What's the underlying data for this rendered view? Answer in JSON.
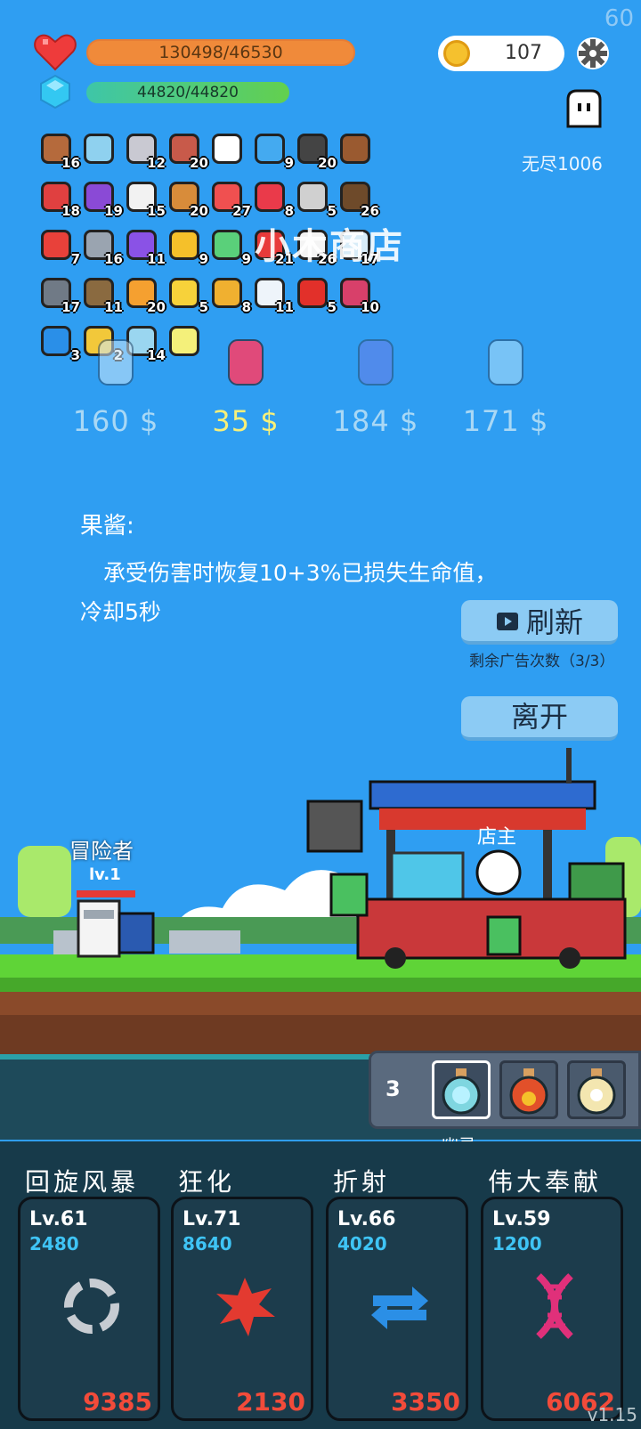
{
  "fps": "60",
  "status": {
    "hp_text": "130498/46530",
    "mp_text": "44820/44820",
    "coins": "107",
    "mode_label": "无尽1006"
  },
  "inventory": [
    {
      "name": "ring-icon",
      "count": "16",
      "color": "#b56a3c"
    },
    {
      "name": "magnifier-icon",
      "count": "",
      "color": "#8fd1ef"
    },
    {
      "name": "sword-icon",
      "count": "12",
      "color": "#c9c9d2"
    },
    {
      "name": "tombstone-icon",
      "count": "20",
      "color": "#c85a4a"
    },
    {
      "name": "target-icon",
      "count": "",
      "color": "#ffffff"
    },
    {
      "name": "speech-bubble-icon",
      "count": "9",
      "color": "#44aaf0"
    },
    {
      "name": "bomb-icon",
      "count": "20",
      "color": "#444444"
    },
    {
      "name": "treasure-chest-icon",
      "count": "",
      "color": "#9a5a30"
    },
    {
      "name": "shield-icon",
      "count": "18",
      "color": "#e04040"
    },
    {
      "name": "gift-box-icon",
      "count": "19",
      "color": "#8a4ad6"
    },
    {
      "name": "dice-icon",
      "count": "15",
      "color": "#f2f2f2"
    },
    {
      "name": "bow-icon",
      "count": "20",
      "color": "#d88c3a"
    },
    {
      "name": "pill-icon",
      "count": "27",
      "color": "#f05050"
    },
    {
      "name": "hearts-icon",
      "count": "8",
      "color": "#ea3a4a"
    },
    {
      "name": "hook-icon",
      "count": "5",
      "color": "#d0d0d0"
    },
    {
      "name": "coconut-icon",
      "count": "26",
      "color": "#6e4a2a"
    },
    {
      "name": "watermelon-icon",
      "count": "7",
      "color": "#e8413a"
    },
    {
      "name": "elephant-icon",
      "count": "16",
      "color": "#9aa4b0"
    },
    {
      "name": "crystal-ball-icon",
      "count": "11",
      "color": "#8a52e6"
    },
    {
      "name": "sunflower-icon",
      "count": "9",
      "color": "#f5c02a"
    },
    {
      "name": "green-ghost-icon",
      "count": "9",
      "color": "#5ad07a"
    },
    {
      "name": "strawberry-icon",
      "count": "21",
      "color": "#e83a3a"
    },
    {
      "name": "white-ghost-icon",
      "count": "26",
      "color": "#f4f4f4"
    },
    {
      "name": "bubble-icon",
      "count": "17",
      "color": "#d8ecf8"
    },
    {
      "name": "spiked-mace-icon",
      "count": "17",
      "color": "#707a86"
    },
    {
      "name": "arrows-icon",
      "count": "11",
      "color": "#8a6a40"
    },
    {
      "name": "flag-icon",
      "count": "20",
      "color": "#f5a030"
    },
    {
      "name": "magic-wand-icon",
      "count": "5",
      "color": "#f7d23a"
    },
    {
      "name": "book-icon",
      "count": "8",
      "color": "#f0b030"
    },
    {
      "name": "envelope-icon",
      "count": "11",
      "color": "#eef4fa"
    },
    {
      "name": "apple-icon",
      "count": "5",
      "color": "#e2302a"
    },
    {
      "name": "jam-jar-icon",
      "count": "10",
      "color": "#d8406a"
    },
    {
      "name": "blue-gem-icon",
      "count": "3",
      "color": "#2a8fe8"
    },
    {
      "name": "diamond-ring-icon",
      "count": "2",
      "color": "#f2c83a"
    },
    {
      "name": "potion-icon",
      "count": "14",
      "color": "#9ad6f0"
    },
    {
      "name": "light-tile-icon",
      "count": "",
      "color": "#f4f07a"
    }
  ],
  "shop": {
    "title": "小木商店",
    "goods": [
      {
        "name": "lightbulb-icon",
        "price": "160 $",
        "color": "#cfe9fb"
      },
      {
        "name": "jam-jar-icon",
        "price": "35 $",
        "color": "#e04a7a"
      },
      {
        "name": "crystal-ball-icon",
        "price": "184 $",
        "color": "#6b7ce6"
      },
      {
        "name": "ghost-icon",
        "price": "171 $",
        "color": "#b4e2fb"
      }
    ],
    "selected_title": "果酱:",
    "selected_desc": "承受伤害时恢复10+3%已损失生命值，冷却5秒",
    "refresh_label": "刷新",
    "ads_remaining": "剩余广告次数（3/3）",
    "leave_label": "离开"
  },
  "scene": {
    "hero_name": "冒险者",
    "hero_level": "lv.1",
    "shopkeeper_label": "店主",
    "selected_slot_label": "幽灵"
  },
  "slots": {
    "count": "3"
  },
  "skills": [
    {
      "name": "回旋风暴",
      "level": "Lv.61",
      "cost": "2480",
      "damage": "9385",
      "icon": "cycle-icon",
      "color": "#c7ccd2"
    },
    {
      "name": "狂化",
      "level": "Lv.71",
      "cost": "8640",
      "damage": "2130",
      "icon": "splat-icon",
      "color": "#e33a30"
    },
    {
      "name": "折射",
      "level": "Lv.66",
      "cost": "4020",
      "damage": "3350",
      "icon": "swap-arrows-icon",
      "color": "#2b8fe6"
    },
    {
      "name": "伟大奉献",
      "level": "Lv.59",
      "cost": "1200",
      "damage": "6062",
      "icon": "dna-icon",
      "color": "#e0307a"
    }
  ],
  "version": "v1.15"
}
